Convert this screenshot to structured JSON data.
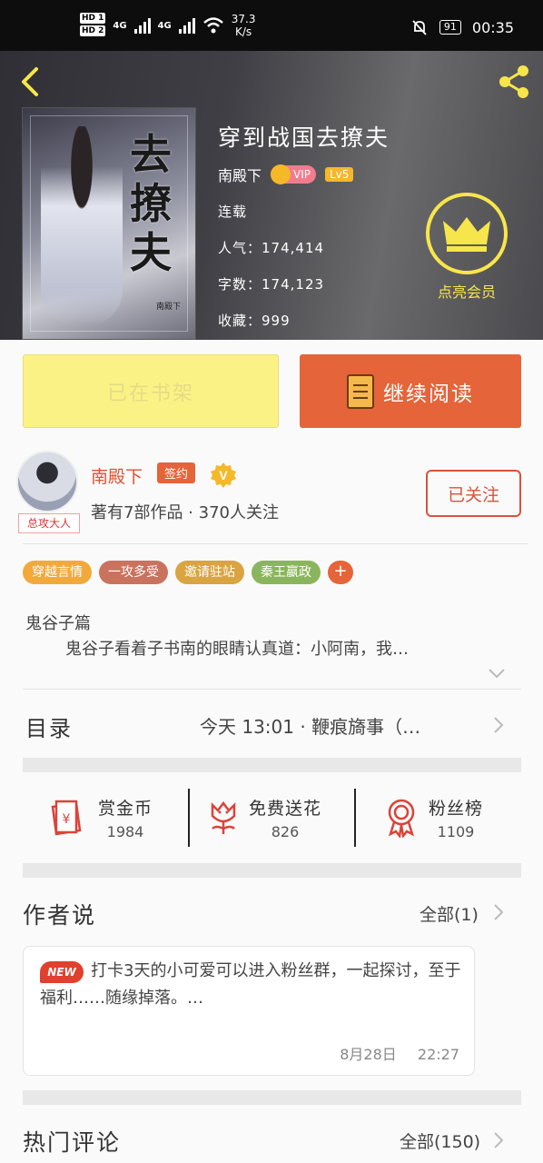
{
  "status_bar": {
    "hd1": "HD 1",
    "hd2": "HD 2",
    "net1": "4G",
    "net2": "4G",
    "speed_value": "37.3",
    "speed_unit": "K/s",
    "battery": "91",
    "time": "00:35"
  },
  "book": {
    "title": "穿到战国去撩夫",
    "author": "南殿下",
    "vip_label": "VIP",
    "level": "Lv5",
    "status": "连载",
    "popularity": "人气：174,414",
    "word_count": "字数：174,123",
    "favorites": "收藏：999",
    "cover_title": "去撩夫",
    "cover_author": "南殿下"
  },
  "member": {
    "label": "点亮会员"
  },
  "actions": {
    "shelf_label": "已在书架",
    "read_label": "继续阅读"
  },
  "author": {
    "name": "南殿下",
    "sign_label": "签约",
    "v_badge": "V",
    "stats": "著有7部作品 · 370人关注",
    "avatar_caption": "总攻大人",
    "follow_label": "已关注"
  },
  "tags": [
    {
      "label": "穿越言情",
      "color": "#f2a93b"
    },
    {
      "label": "一攻多受",
      "color": "#c9735e"
    },
    {
      "label": "邀请驻站",
      "color": "#d9a441"
    },
    {
      "label": "秦王嬴政",
      "color": "#8bb55d"
    }
  ],
  "tag_more": "+",
  "summary": {
    "title": "鬼谷子篇",
    "text": "鬼谷子看着子书南的眼睛认真道：小阿南，我…"
  },
  "toc": {
    "label": "目录",
    "latest": "今天 13:01 · 鞭痕旖事（…"
  },
  "stats": [
    {
      "label": "赏金币",
      "value": "1984",
      "icon": "red-envelope-icon"
    },
    {
      "label": "免费送花",
      "value": "826",
      "icon": "flower-icon"
    },
    {
      "label": "粉丝榜",
      "value": "1109",
      "icon": "medal-icon"
    }
  ],
  "author_says": {
    "title": "作者说",
    "all_label": "全部(1)",
    "new_badge": "NEW",
    "text": "打卡3天的小可爱可以进入粉丝群，一起探讨，至于福利……随缘掉落。…",
    "date": "8月28日",
    "time": "22:27"
  },
  "hot_comments": {
    "title": "热门评论",
    "all_label": "全部(150)"
  },
  "colors": {
    "accent": "#e6643a",
    "shelf_bg": "#fbf286",
    "member_gold": "#f7e64b"
  }
}
